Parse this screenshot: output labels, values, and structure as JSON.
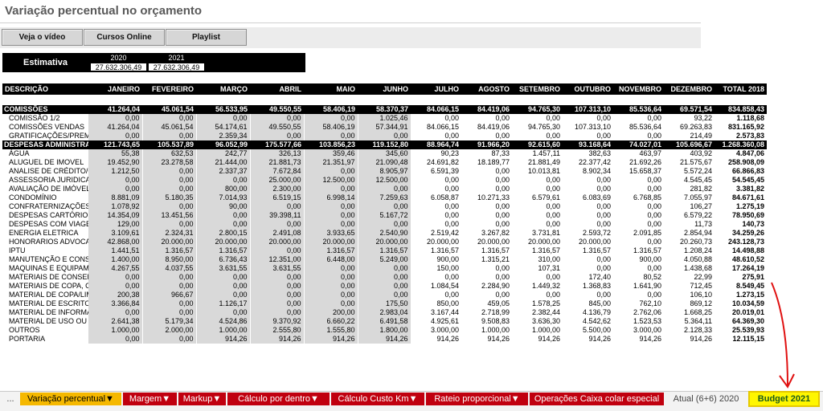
{
  "title": "Variação percentual no orçamento",
  "buttons": [
    "Veja o vídeo",
    "Cursos Online",
    "Playlist"
  ],
  "estimativa": {
    "label": "Estimativa",
    "year1": "2020",
    "year2": "2021",
    "val1": "27.632.306,49",
    "val2": "27.632.306,49"
  },
  "table": {
    "headers": [
      "DESCRIÇÃO",
      "JANEIRO",
      "FEVEREIRO",
      "MARÇO",
      "ABRIL",
      "MAIO",
      "JUNHO",
      "JULHO",
      "AGOSTO",
      "SETEMBRO",
      "OUTUBRO",
      "NOVEMBRO",
      "DEZEMBRO",
      "TOTAL 2018"
    ],
    "rows": [
      {
        "type": "group",
        "cells": [
          "COMISSÕES",
          "41.264,04",
          "45.061,54",
          "56.533,95",
          "49.550,55",
          "58.406,19",
          "58.370,37",
          "84.066,15",
          "84.419,06",
          "94.765,30",
          "107.313,10",
          "85.536,64",
          "69.571,54",
          "834.858,43"
        ]
      },
      {
        "type": "item",
        "cells": [
          "COMISSÃO 1/2",
          "0,00",
          "0,00",
          "0,00",
          "0,00",
          "0,00",
          "1.025,46",
          "0,00",
          "0,00",
          "0,00",
          "0,00",
          "0,00",
          "93,22",
          "1.118,68"
        ]
      },
      {
        "type": "item",
        "cells": [
          "COMISSÕES VENDAS",
          "41.264,04",
          "45.061,54",
          "54.174,61",
          "49.550,55",
          "58.406,19",
          "57.344,91",
          "84.066,15",
          "84.419,06",
          "94.765,30",
          "107.313,10",
          "85.536,64",
          "69.263,83",
          "831.165,92"
        ]
      },
      {
        "type": "item",
        "cells": [
          "GRATIFICAÇÕES/PREMIA",
          "0,00",
          "0,00",
          "2.359,34",
          "0,00",
          "0,00",
          "0,00",
          "0,00",
          "0,00",
          "0,00",
          "0,00",
          "0,00",
          "214,49",
          "2.573,83"
        ]
      },
      {
        "type": "group",
        "cells": [
          "DESPESAS ADMINISTRAT",
          "121.743,65",
          "105.537,89",
          "96.052,99",
          "175.577,66",
          "103.856,23",
          "119.152,80",
          "88.964,74",
          "91.966,20",
          "92.615,60",
          "93.168,64",
          "74.027,01",
          "105.696,67",
          "1.268.360,08"
        ]
      },
      {
        "type": "item",
        "cells": [
          "ÁGUA",
          "55,38",
          "632,53",
          "242,77",
          "326,13",
          "359,46",
          "345,60",
          "90,23",
          "87,33",
          "1.457,11",
          "382,63",
          "463,97",
          "403,92",
          "4.847,06"
        ]
      },
      {
        "type": "item",
        "cells": [
          "ALUGUEL DE IMOVEL",
          "19.452,90",
          "23.278,58",
          "21.444,00",
          "21.881,73",
          "21.351,97",
          "21.090,48",
          "24.691,82",
          "18.189,77",
          "21.881,49",
          "22.377,42",
          "21.692,26",
          "21.575,67",
          "258.908,09"
        ]
      },
      {
        "type": "item",
        "cells": [
          "ANALISE DE CRÉDITO/G",
          "1.212,50",
          "0,00",
          "2.337,37",
          "7.672,84",
          "0,00",
          "8.905,97",
          "6.591,39",
          "0,00",
          "10.013,81",
          "8.902,34",
          "15.658,37",
          "5.572,24",
          "66.866,83"
        ]
      },
      {
        "type": "item",
        "cells": [
          "ASSESSORIA JURIDICA",
          "0,00",
          "0,00",
          "0,00",
          "25.000,00",
          "12.500,00",
          "12.500,00",
          "0,00",
          "0,00",
          "0,00",
          "0,00",
          "0,00",
          "4.545,45",
          "54.545,45"
        ]
      },
      {
        "type": "item",
        "cells": [
          "AVALIAÇÃO DE IMÓVEL",
          "0,00",
          "0,00",
          "800,00",
          "2.300,00",
          "0,00",
          "0,00",
          "0,00",
          "0,00",
          "0,00",
          "0,00",
          "0,00",
          "281,82",
          "3.381,82"
        ]
      },
      {
        "type": "item",
        "cells": [
          "CONDOMÍNIO",
          "8.881,09",
          "5.180,35",
          "7.014,93",
          "6.519,15",
          "6.998,14",
          "7.259,63",
          "6.058,87",
          "10.271,33",
          "6.579,61",
          "6.083,69",
          "6.768,85",
          "7.055,97",
          "84.671,61"
        ]
      },
      {
        "type": "item",
        "cells": [
          "CONFRATERNIZAÇÕES",
          "1.078,92",
          "0,00",
          "90,00",
          "0,00",
          "0,00",
          "0,00",
          "0,00",
          "0,00",
          "0,00",
          "0,00",
          "0,00",
          "106,27",
          "1.275,19"
        ]
      },
      {
        "type": "item",
        "cells": [
          "DESPESAS CARTÓRIO",
          "14.354,09",
          "13.451,56",
          "0,00",
          "39.398,11",
          "0,00",
          "5.167,72",
          "0,00",
          "0,00",
          "0,00",
          "0,00",
          "0,00",
          "6.579,22",
          "78.950,69"
        ]
      },
      {
        "type": "item",
        "cells": [
          "DESPESAS COM VIAGEN",
          "129,00",
          "0,00",
          "0,00",
          "0,00",
          "0,00",
          "0,00",
          "0,00",
          "0,00",
          "0,00",
          "0,00",
          "0,00",
          "11,73",
          "140,73"
        ]
      },
      {
        "type": "item",
        "cells": [
          "ENERGIA ELETRICA",
          "3.109,61",
          "2.324,31",
          "2.800,15",
          "2.491,08",
          "3.933,65",
          "2.540,90",
          "2.519,42",
          "3.267,82",
          "3.731,81",
          "2.593,72",
          "2.091,85",
          "2.854,94",
          "34.259,26"
        ]
      },
      {
        "type": "item",
        "cells": [
          "HONORARIOS ADVOCAT",
          "42.868,00",
          "20.000,00",
          "20.000,00",
          "20.000,00",
          "20.000,00",
          "20.000,00",
          "20.000,00",
          "20.000,00",
          "20.000,00",
          "20.000,00",
          "0,00",
          "20.260,73",
          "243.128,73"
        ]
      },
      {
        "type": "item",
        "cells": [
          "IPTU",
          "1.441,51",
          "1.316,57",
          "1.316,57",
          "0,00",
          "1.316,57",
          "1.316,57",
          "1.316,57",
          "1.316,57",
          "1.316,57",
          "1.316,57",
          "1.316,57",
          "1.208,24",
          "14.498,88"
        ]
      },
      {
        "type": "item",
        "cells": [
          "MANUTENÇÃO E CONSE",
          "1.400,00",
          "8.950,00",
          "6.736,43",
          "12.351,00",
          "6.448,00",
          "5.249,00",
          "900,00",
          "1.315,21",
          "310,00",
          "0,00",
          "900,00",
          "4.050,88",
          "48.610,52"
        ]
      },
      {
        "type": "item",
        "cells": [
          "MAQUINAS E EQUIPAM",
          "4.267,55",
          "4.037,55",
          "3.631,55",
          "3.631,55",
          "0,00",
          "0,00",
          "150,00",
          "0,00",
          "107,31",
          "0,00",
          "0,00",
          "1.438,68",
          "17.264,19"
        ]
      },
      {
        "type": "item",
        "cells": [
          "MATERIAIS DE CONSERV",
          "0,00",
          "0,00",
          "0,00",
          "0,00",
          "0,00",
          "0,00",
          "0,00",
          "0,00",
          "0,00",
          "172,40",
          "80,52",
          "22,99",
          "275,91"
        ]
      },
      {
        "type": "item",
        "cells": [
          "MATERIAIS DE COPA, CO",
          "0,00",
          "0,00",
          "0,00",
          "0,00",
          "0,00",
          "0,00",
          "1.084,54",
          "2.284,90",
          "1.449,32",
          "1.368,83",
          "1.641,90",
          "712,45",
          "8.549,45"
        ]
      },
      {
        "type": "item",
        "cells": [
          "MATERIAL DE COPA/LIM",
          "200,38",
          "966,67",
          "0,00",
          "0,00",
          "0,00",
          "0,00",
          "0,00",
          "0,00",
          "0,00",
          "0,00",
          "0,00",
          "106,10",
          "1.273,15"
        ]
      },
      {
        "type": "item",
        "cells": [
          "MATERIAL DE ESCRITOF",
          "3.366,84",
          "0,00",
          "1.126,17",
          "0,00",
          "0,00",
          "175,50",
          "850,00",
          "459,05",
          "1.578,25",
          "845,00",
          "762,10",
          "869,12",
          "10.034,59"
        ]
      },
      {
        "type": "item",
        "cells": [
          "MATERIAL DE INFORMA",
          "0,00",
          "0,00",
          "0,00",
          "0,00",
          "200,00",
          "2.983,04",
          "3.167,44",
          "2.718,99",
          "2.382,44",
          "4.136,79",
          "2.762,06",
          "1.668,25",
          "20.019,01"
        ]
      },
      {
        "type": "item",
        "cells": [
          "MATERIAL DE USO OU C",
          "2.641,38",
          "5.179,34",
          "4.524,86",
          "9.370,92",
          "6.660,22",
          "6.491,58",
          "4.925,61",
          "9.508,83",
          "3.636,30",
          "4.542,62",
          "1.523,53",
          "5.364,11",
          "64.369,30"
        ]
      },
      {
        "type": "item",
        "cells": [
          "OUTROS",
          "1.000,00",
          "2.000,00",
          "1.000,00",
          "2.555,80",
          "1.555,80",
          "1.800,00",
          "3.000,00",
          "1.000,00",
          "1.000,00",
          "5.500,00",
          "3.000,00",
          "2.128,33",
          "25.539,93"
        ]
      },
      {
        "type": "item",
        "cells": [
          "PORTARIA",
          "0,00",
          "0,00",
          "914,26",
          "914,26",
          "914,26",
          "914,26",
          "914,26",
          "914,26",
          "914,26",
          "914,26",
          "914,26",
          "914,26",
          "12.115,15"
        ]
      }
    ]
  },
  "tabs": [
    {
      "label": "...",
      "style": "plain",
      "interactable": true
    },
    {
      "label": "Variação percentual▼",
      "style": "orange",
      "interactable": true
    },
    {
      "label": "Margem▼",
      "style": "red",
      "interactable": true
    },
    {
      "label": "Markup▼",
      "style": "red",
      "interactable": true
    },
    {
      "label": "Cálculo por dentro▼",
      "style": "red",
      "interactable": true
    },
    {
      "label": "Cálculo Custo Km▼",
      "style": "red",
      "interactable": true
    },
    {
      "label": "Rateio proporcional▼",
      "style": "red",
      "interactable": true
    },
    {
      "label": "Operações Caixa colar especial",
      "style": "red",
      "interactable": true
    },
    {
      "label": "Atual (6+6) 2020",
      "style": "plain",
      "interactable": true
    },
    {
      "label": "Budget 2021",
      "style": "active",
      "interactable": true
    }
  ],
  "colors": {
    "group_bg": "#000000",
    "gray_cell": "#d9d9d9",
    "tab_red": "#c0000f",
    "tab_orange": "#f5b800",
    "tab_active": "#fff600",
    "annotation": "#e01010"
  }
}
